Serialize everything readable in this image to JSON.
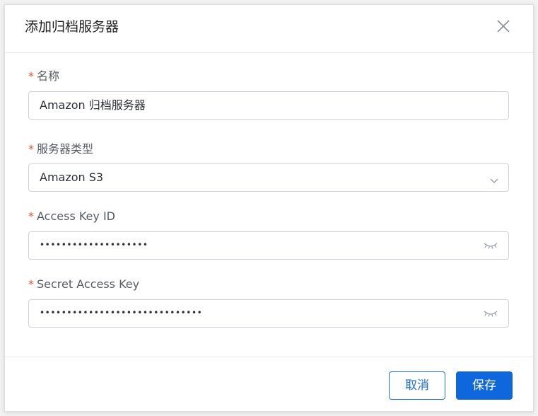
{
  "dialog": {
    "title": "添加归档服务器",
    "close_icon": "close-icon"
  },
  "form": {
    "required_mark": "*",
    "name": {
      "label": "名称",
      "value": "Amazon 归档服务器"
    },
    "server_type": {
      "label": "服务器类型",
      "value": "Amazon S3",
      "icon": "chevron-down-icon"
    },
    "access_key_id": {
      "label": "Access Key ID",
      "value": "••••••••••••••••••••",
      "icon": "eye-closed-icon"
    },
    "secret_access_key": {
      "label": "Secret Access Key",
      "value": "••••••••••••••••••••••••••••••",
      "icon": "eye-closed-icon"
    }
  },
  "footer": {
    "cancel_label": "取消",
    "save_label": "保存"
  },
  "colors": {
    "primary": "#0e67dc",
    "required": "#e8572f",
    "border": "#cfd3d9"
  }
}
